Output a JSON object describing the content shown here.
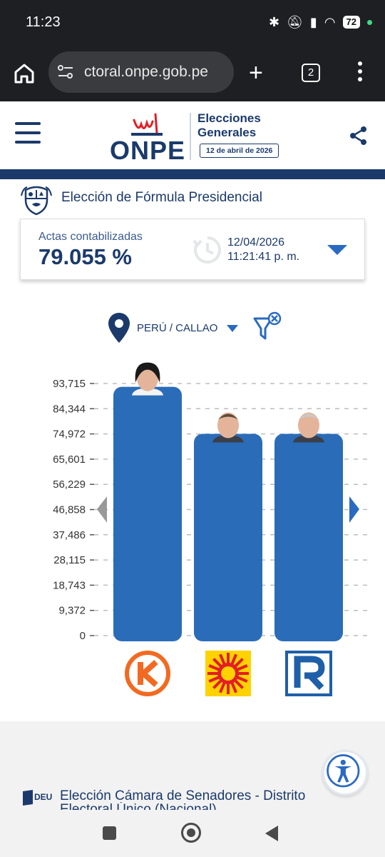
{
  "status": {
    "time": "11:23",
    "battery": "72",
    "icons": [
      "bluetooth-icon",
      "mute-icon",
      "signal-icon",
      "wifi-icon",
      "battery-icon"
    ]
  },
  "browser": {
    "url": "ctoral.onpe.gob.pe",
    "tab_count": "2"
  },
  "header": {
    "logo_text": "ONPE",
    "title_line1": "Elecciones",
    "title_line2": "Generales",
    "date_badge": "12 de abril de 2026"
  },
  "section": {
    "title": "Elección de Fórmula Presidencial"
  },
  "actas": {
    "label": "Actas contabilizadas",
    "value": "79.055 %",
    "date": "12/04/2026",
    "time": "11:21:41 p. m."
  },
  "filter": {
    "region": "PERÚ / CALLAO"
  },
  "chart_data": {
    "type": "bar",
    "categories": [
      "Fuerza Popular",
      "Partido Cívico Obras",
      "Renovación Popular"
    ],
    "values": [
      92500,
      75000,
      75000
    ],
    "yticks": [
      "93,715",
      "84,344",
      "74,972",
      "65,601",
      "56,229",
      "46,858",
      "37,486",
      "28,115",
      "18,743",
      "9,372",
      "0"
    ],
    "ylim": [
      0,
      93715
    ],
    "bar_color": "#2b6cb8",
    "grid": true
  },
  "colors": {
    "brand_navy": "#1b3a6b",
    "accent_blue": "#2a6ac1",
    "party_orange": "#f26a21",
    "party_red": "#e31e24",
    "party_yellow": "#ffd200",
    "party_blue": "#1f5fa8"
  },
  "next_section": {
    "title": "Elección Cámara de Senadores - Distrito",
    "subtitle": "Electoral Único (Nacional)",
    "badge": "DEU"
  }
}
